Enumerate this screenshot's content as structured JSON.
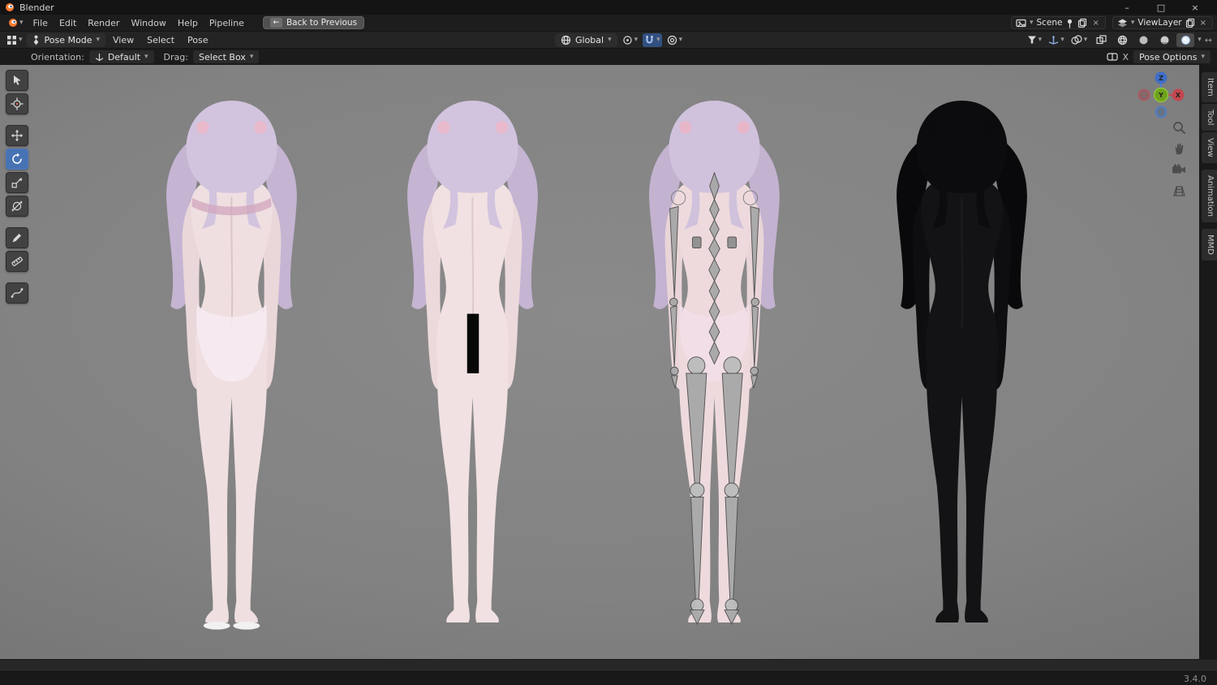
{
  "icons": {
    "dropdown": "▾",
    "back_arrow": "←",
    "minimize": "–",
    "maximize": "□",
    "close": "×",
    "unlink": "×",
    "h_arrows": "↔"
  },
  "titlebar": {
    "app_title": "Blender"
  },
  "menubar": {
    "menus": [
      {
        "label": "File"
      },
      {
        "label": "Edit"
      },
      {
        "label": "Render"
      },
      {
        "label": "Window"
      },
      {
        "label": "Help"
      },
      {
        "label": "Pipeline"
      }
    ],
    "back_button_label": "Back to Previous",
    "scene_selector": "Scene",
    "viewlayer_selector": "ViewLayer"
  },
  "viewport_header": {
    "mode": "Pose Mode",
    "menus": [
      {
        "label": "View"
      },
      {
        "label": "Select"
      },
      {
        "label": "Pose"
      }
    ],
    "orientation": "Global"
  },
  "tool_settings": {
    "orientation_label": "Orientation:",
    "orientation_value": "Default",
    "drag_label": "Drag:",
    "drag_value": "Select Box",
    "x_mirror_label": "X",
    "pose_options_label": "Pose Options"
  },
  "left_toolbar": {
    "active_tool": "rotate",
    "tools": [
      "select-box",
      "cursor",
      "move",
      "rotate",
      "scale",
      "transform",
      "annotate",
      "measure",
      "extra"
    ]
  },
  "viewport": {
    "gizmo": {
      "z": "Z",
      "y": "Y",
      "x": "X"
    },
    "figures": [
      "textured-model",
      "nude-model-censored",
      "armature-overlay-model",
      "wireframe-model"
    ]
  },
  "sidebar_tabs": [
    {
      "label": "Item"
    },
    {
      "label": "Tool"
    },
    {
      "label": "View"
    },
    {
      "label": "Animation"
    },
    {
      "label": "MMD"
    }
  ],
  "statusbar": {
    "version": "3.4.0"
  },
  "colors": {
    "accent_blue": "#4772b3",
    "viewport_bg": "#828282",
    "hair_pink": "#cdbdd8",
    "skin": "#eedde0"
  }
}
